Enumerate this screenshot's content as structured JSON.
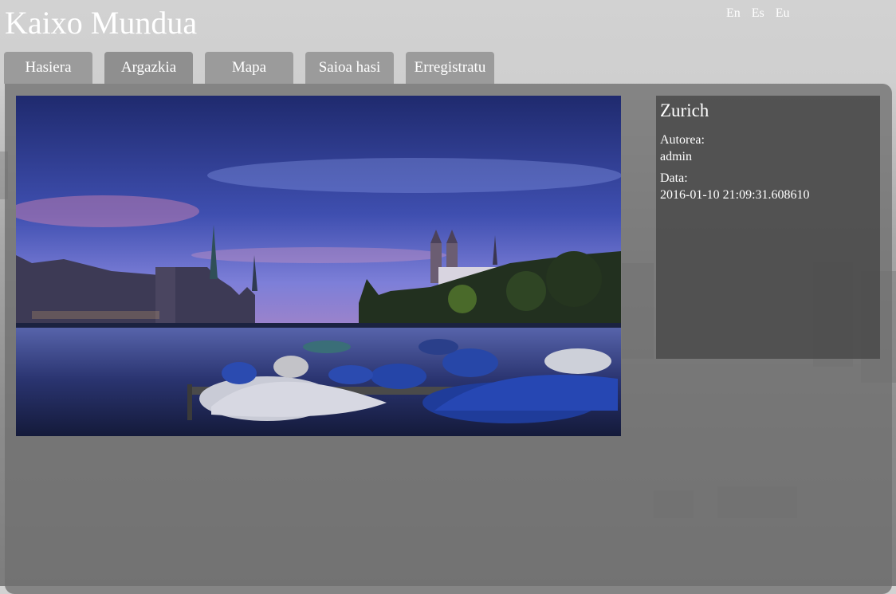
{
  "site": {
    "title": "Kaixo Mundua"
  },
  "languages": [
    "En",
    "Es",
    "Eu"
  ],
  "nav": {
    "tabs": [
      "Hasiera",
      "Argazkia",
      "Mapa",
      "Saioa hasi",
      "Erregistratu"
    ],
    "active": "Argazkia"
  },
  "photo": {
    "title": "Zurich",
    "author_label": "Autorea:",
    "author": "admin",
    "date_label": "Data:",
    "date": "2016-01-10 21:09:31.608610"
  },
  "colors": {
    "panel": "#707070",
    "info_box": "#4a4a4a",
    "tab": "#9b9b9b"
  }
}
